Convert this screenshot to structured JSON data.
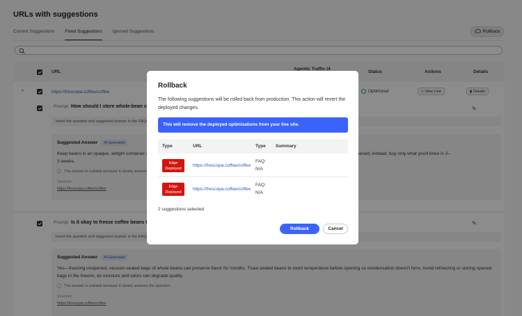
{
  "page": {
    "title": "URLs with suggestions",
    "tabs": [
      {
        "label": "Current Suggestions",
        "active": false
      },
      {
        "label": "Fixed Suggestions",
        "active": true
      },
      {
        "label": "Ignored Suggestions",
        "active": false
      }
    ],
    "rollback_label": "Rollback",
    "search_placeholder": ""
  },
  "table": {
    "headers": {
      "url": "URL",
      "traffic": "Agentic Traffic (4",
      "status": "Status",
      "actions": "Actions",
      "details": "Details"
    },
    "row": {
      "url": "https://frescopa.coffee/coffee",
      "status": "Optimized",
      "view_live": "View Live",
      "details": "Details"
    },
    "suggestions": [
      {
        "prompt_label": "Prompt",
        "prompt": "How should I store whole-bean coffe",
        "instruction": "Insert the question and suggested answer in the FAQs se",
        "answer_heading": "Suggested Answer",
        "ai_badge": "AI-Generated",
        "answer_text_left": "Keep beans in an opaque, airtight container at r",
        "answer_text_right": "bag is opened; instead, buy only what you'll brew in 2–",
        "answer_text_line2": "3 weeks.",
        "note": "The answer is suitable because it clearly answers th",
        "sources_label": "Sources:",
        "source_link": "https://frescopa.coffee/coffee"
      },
      {
        "prompt_label": "Prompt",
        "prompt": "Is it okay to freeze coffee beans to e",
        "instruction": "Insert the question and suggested answer in the FAQs se",
        "answer_heading": "Suggested Answer",
        "ai_badge": "AI-Generated",
        "answer_text": "Yes—freezing unopened, vacuum-sealed bags of whole beans can preserve flavor for months. Thaw sealed beans to room temperature before opening so condensation doesn't form. Avoid refreezing or storing opened bags in the freezer, as moisture and odors can degrade quality.",
        "note": "The answer is suitable because it clearly answers the question.",
        "sources_label": "Sources:",
        "source_link": "https://frescopa.coffee/coffee"
      }
    ]
  },
  "modal": {
    "title": "Rollback",
    "description": "The following suggestions will be rolled back from production. This action will revert the deployed changes.",
    "banner": "This will remove the deployed optimizations from your live site.",
    "headers": {
      "type": "Type",
      "url": "URL",
      "type2": "Type",
      "summary": "Summary"
    },
    "rows": [
      {
        "badge_line1": "Edge",
        "badge_line2": "Deployed",
        "url": "https://frescopa.coffee/coffee",
        "type_line1": "FAQ:",
        "type_line2": "N/A"
      },
      {
        "badge_line1": "Edge",
        "badge_line2": "Deployed",
        "url": "https://frescopa.coffee/coffee",
        "type_line1": "FAQ:",
        "type_line2": "N/A"
      }
    ],
    "selected_count": "2 suggestions selected",
    "primary_label": "Rollback",
    "secondary_label": "Cancel"
  },
  "colors": {
    "accent": "#3b63fb",
    "edge_badge": "#d31510",
    "link": "#2b59c3"
  }
}
